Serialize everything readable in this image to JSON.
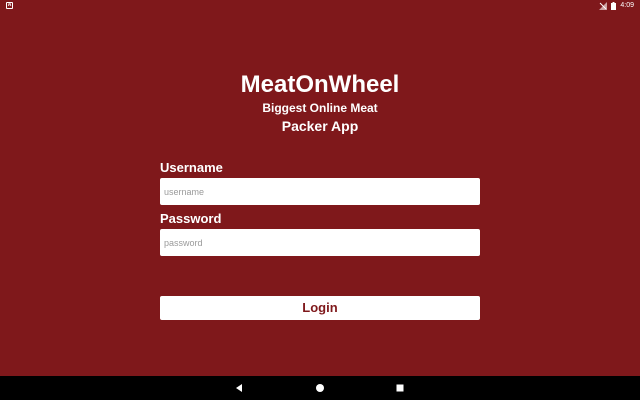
{
  "status_bar": {
    "left_icon": "A",
    "time": "4:09",
    "icons": [
      "signal-off-icon",
      "battery-icon"
    ]
  },
  "header": {
    "title": "MeatOnWheel",
    "subtitle_line1": "Biggest Online Meat",
    "subtitle_line2": "Packer App"
  },
  "form": {
    "username_label": "Username",
    "username_placeholder": "username",
    "username_value": "",
    "password_label": "Password",
    "password_placeholder": "password",
    "password_value": "",
    "login_label": "Login"
  },
  "nav_bar": {
    "icons": [
      "back-icon",
      "home-icon",
      "recents-icon"
    ]
  },
  "colors": {
    "background": "#7f181b",
    "surface": "#ffffff",
    "button_text": "#7f181b",
    "nav_bar": "#000000"
  }
}
